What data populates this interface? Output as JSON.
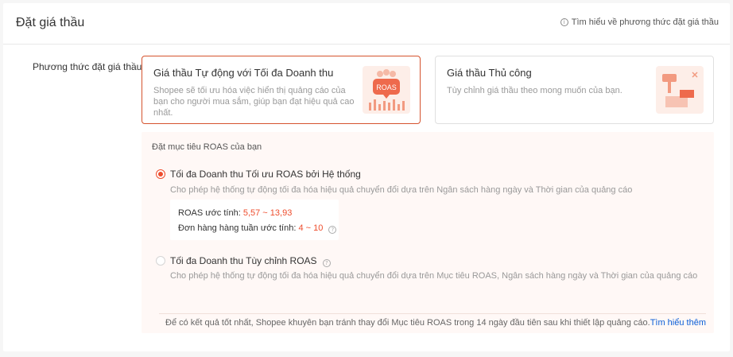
{
  "header": {
    "title": "Đặt giá thầu",
    "help_link": "Tìm hiểu về phương thức đặt giá thầu",
    "help_icon": "info-icon"
  },
  "bidding_method": {
    "label": "Phương thức đặt giá thầu",
    "auto": {
      "title": "Giá thầu Tự động với Tối đa Doanh thu",
      "description": "Shopee sẽ tối ưu hóa việc hiển thị quảng cáo của bạn cho người mua sắm, giúp bạn đạt hiệu quả cao nhất.",
      "illustration_text": "ROAS",
      "selected": true
    },
    "manual": {
      "title": "Giá thầu Thủ công",
      "description": "Tùy chỉnh giá thầu theo mong muốn của bạn.",
      "selected": false
    }
  },
  "roas_target": {
    "title": "Đặt mục tiêu ROAS của bạn",
    "option_system": {
      "label": "Tối đa Doanh thu Tối ưu ROAS bởi Hệ thống",
      "description": "Cho phép hệ thống tự động tối đa hóa hiệu quả chuyển đổi dựa trên Ngân sách hàng ngày và Thời gian của quảng cáo",
      "checked": true
    },
    "estimate": {
      "roas_label": "ROAS ước tính:",
      "roas_value": "5,57 ~ 13,93",
      "orders_label": "Đơn hàng hàng tuần ước tính:",
      "orders_value": "4 ~ 10"
    },
    "option_custom": {
      "label": "Tối đa Doanh thu Tùy chỉnh ROAS",
      "description": "Cho phép hệ thống tự động tối đa hóa hiệu quả chuyển đổi dựa trên Mục tiêu ROAS, Ngân sách hàng ngày và Thời gian của quảng cáo",
      "checked": false
    },
    "footer_note": "Để có kết quả tốt nhất, Shopee khuyên bạn tránh thay đổi Mục tiêu ROAS trong 14 ngày đầu tiên sau khi thiết lập quảng cáo.",
    "learn_more": "Tìm hiểu thêm"
  },
  "colors": {
    "accent": "#ee4d2d",
    "link": "#0b5ed7",
    "section_bg": "#fff8f6"
  }
}
